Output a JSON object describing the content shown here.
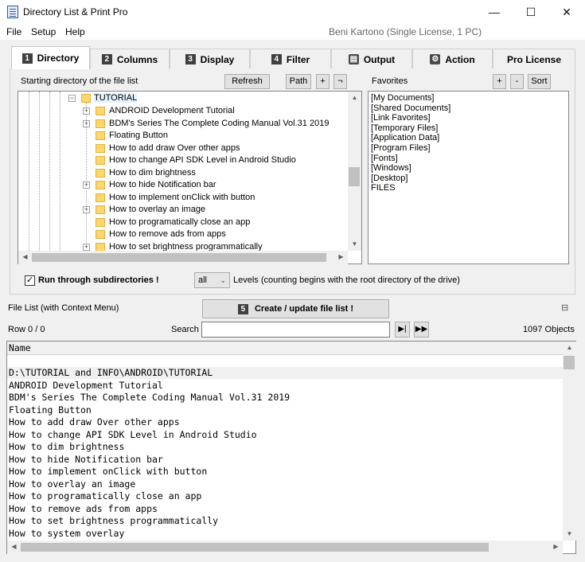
{
  "window": {
    "title": "Directory List & Print Pro",
    "minimize": "—",
    "maximize": "☐",
    "close": "✕"
  },
  "menu": {
    "items": [
      "File",
      "Setup",
      "Help"
    ],
    "license_text": "Beni Kartono (Single License, 1 PC)"
  },
  "tabs": [
    {
      "num": "1",
      "label": "Directory",
      "active": true
    },
    {
      "num": "2",
      "label": "Columns",
      "active": false
    },
    {
      "num": "3",
      "label": "Display",
      "active": false
    },
    {
      "num": "4",
      "label": "Filter",
      "active": false
    },
    {
      "icon": "document-icon",
      "label": "Output",
      "active": false
    },
    {
      "icon": "gear-icon",
      "label": "Action",
      "active": false
    },
    {
      "label": "Pro License",
      "active": false
    }
  ],
  "directory": {
    "starting_label": "Starting directory of the file list",
    "refresh": "Refresh",
    "path": "Path",
    "add": "+",
    "not": "¬",
    "tree": {
      "root": "TUTORIAL",
      "items": [
        {
          "label": "ANDROID Development Tutorial",
          "expandable": true
        },
        {
          "label": "BDM's Series The Complete Coding Manual Vol.31 2019",
          "expandable": true
        },
        {
          "label": "Floating Button",
          "expandable": false
        },
        {
          "label": "How to add draw Over other apps",
          "expandable": false
        },
        {
          "label": "How to change API SDK Level in Android Studio",
          "expandable": false
        },
        {
          "label": "How to dim brightness",
          "expandable": false
        },
        {
          "label": "How to hide Notification bar",
          "expandable": true
        },
        {
          "label": "How to implement onClick with button",
          "expandable": false
        },
        {
          "label": "How to overlay an image",
          "expandable": true
        },
        {
          "label": "How to programatically close an app",
          "expandable": false
        },
        {
          "label": "How to remove ads from apps",
          "expandable": false
        },
        {
          "label": "How to set brightness programmatically",
          "expandable": true
        }
      ]
    },
    "favorites_label": "Favorites",
    "fav_add": "+",
    "fav_remove": "-",
    "fav_sort": "Sort",
    "favorites": [
      "[My Documents]",
      "[Shared Documents]",
      "[Link Favorites]",
      "[Temporary Files]",
      "[Application Data]",
      "[Program Files]",
      "[Fonts]",
      "[Windows]",
      "[Desktop]",
      "FILES"
    ],
    "subdirs_label": "Run through subdirectories !",
    "subdirs_checked": true,
    "levels_value": "all",
    "levels_text": "Levels  (counting begins with the root directory of the drive)"
  },
  "filelist": {
    "label": "File List (with Context Menu)",
    "create_num": "5",
    "create_label": "Create / update file list !",
    "row_text": "Row 0 / 0",
    "search_label": "Search",
    "search_value": "",
    "objects_text": "1097 Objects",
    "column_header": "Name",
    "rows": [
      "D:\\TUTORIAL and INFO\\ANDROID\\TUTORIAL",
      "ANDROID Development Tutorial",
      "BDM's Series The Complete Coding Manual Vol.31 2019",
      "Floating Button",
      "How to add draw Over other apps",
      "How to change API SDK Level in Android Studio",
      "How to dim brightness",
      "How to hide Notification bar",
      "How to implement onClick with button",
      "How to overlay an image",
      "How to programatically close an app",
      "How to remove ads from apps",
      "How to set brightness programmatically",
      "How to system overlay"
    ]
  }
}
